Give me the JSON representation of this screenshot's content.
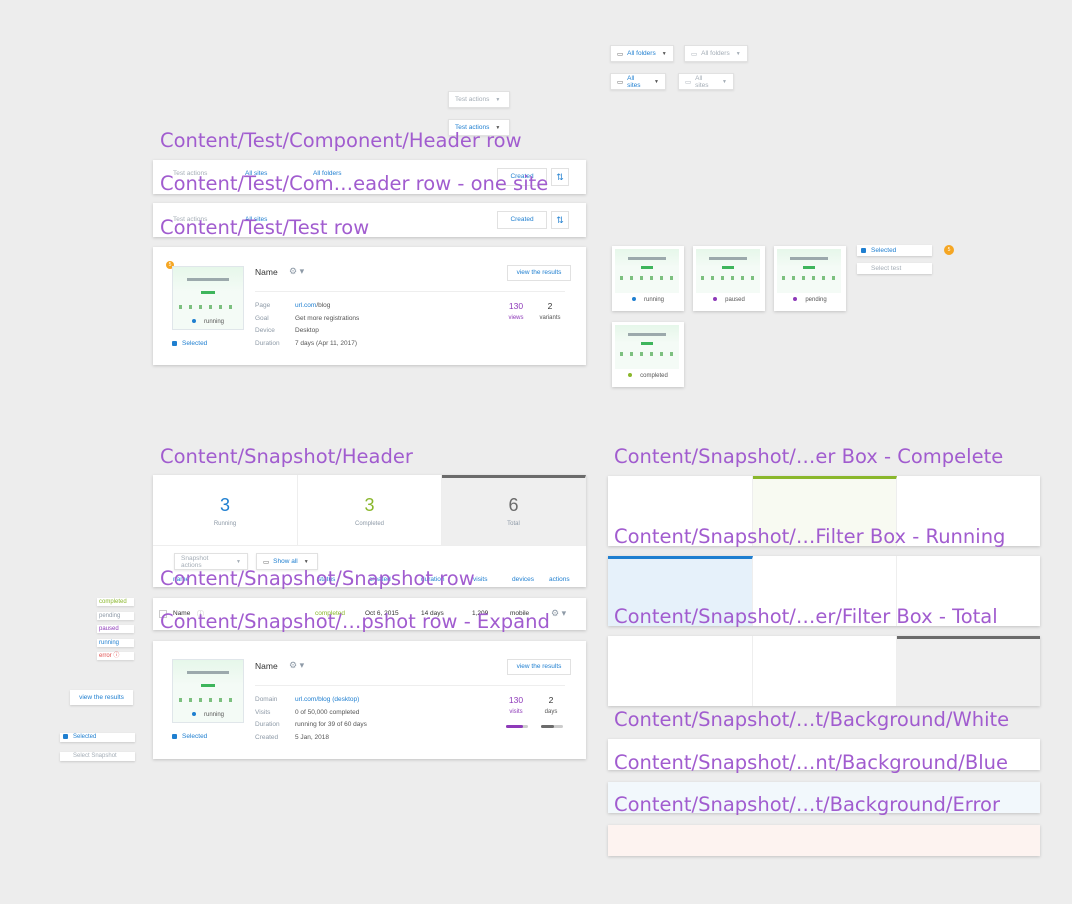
{
  "labels": {
    "header_row": "Content/Test/Component/Header row",
    "header_row_one_site": "Content/Test/Com…eader row - one site",
    "test_row": "Content/Test/Test row",
    "snapshot_header": "Content/Snapshot/Header",
    "snapshot_row": "Content/Snapshot/Snapshot row",
    "snapshot_row_expand": "Content/Snapshot/…pshot row - Expand",
    "filter_complete": "Content/Snapshot/…er Box - Compelete",
    "filter_running": "Content/Snapshot/…Filter Box - Running",
    "filter_total": "Content/Snapshot/…er/Filter Box - Total",
    "bg_white": "Content/Snapshot/…t/Background/White",
    "bg_blue": "Content/Snapshot/…nt/Background/Blue",
    "bg_error": "Content/Snapshot/…t/Background/Error"
  },
  "dropdowns": {
    "all_folders": "All folders",
    "all_sites": "All sites",
    "test_actions": "Test actions",
    "snapshot_actions": "Snapshot actions",
    "show_all": "Show all",
    "created": "Created"
  },
  "test_row": {
    "name": "Name",
    "view_results": "view the results",
    "selected": "Selected",
    "status": "running",
    "badge": "5",
    "thumb_headline": "Grow your website traffic.",
    "fields": [
      {
        "key": "Page",
        "value_a": "url.com",
        "value_b": "/blog"
      },
      {
        "key": "Goal",
        "value_a": "",
        "value_b": "Get more registrations"
      },
      {
        "key": "Device",
        "value_a": "",
        "value_b": "Desktop"
      },
      {
        "key": "Duration",
        "value_a": "",
        "value_b": "7 days (Apr 11, 2017)"
      }
    ],
    "views_value": "130",
    "views_label": "views",
    "variants_value": "2",
    "variants_label": "variants"
  },
  "thumbs": [
    {
      "status": "running",
      "color": "#1f7fd0"
    },
    {
      "status": "paused",
      "color": "#8e3ab9"
    },
    {
      "status": "pending",
      "color": "#8e3ab9"
    },
    {
      "status": "completed",
      "color": "#8ab72c"
    }
  ],
  "select_widget": {
    "selected": "Selected",
    "select_test": "Select test",
    "badge": "5"
  },
  "snapshot_header": {
    "boxes": [
      {
        "value": "3",
        "label": "Running"
      },
      {
        "value": "3",
        "label": "Completed"
      },
      {
        "value": "6",
        "label": "Total"
      }
    ],
    "columns": [
      "name",
      "status",
      "created",
      "duration",
      "visits",
      "devices",
      "actions"
    ]
  },
  "snapshot_row": {
    "name": "Name",
    "status": "completed",
    "date": "Oct 6, 2015",
    "duration": "14 days",
    "visits": "1,209",
    "device": "mobile"
  },
  "status_chips": [
    {
      "label": "completed",
      "color": "#8ab72c"
    },
    {
      "label": "pending",
      "color": "#8e9aa7"
    },
    {
      "label": "paused",
      "color": "#8e3ab9"
    },
    {
      "label": "running",
      "color": "#1f7fd0"
    },
    {
      "label": "error",
      "color": "#e04c4c"
    }
  ],
  "snapshot_expand": {
    "name": "Name",
    "view_results": "view the results",
    "selected": "Selected",
    "select_snapshot": "Select Snapshot",
    "status": "running",
    "fields": [
      {
        "key": "Domain",
        "value_a": "url.com",
        "value_b": "/blog",
        "value_c": "(desktop)"
      },
      {
        "key": "Visits",
        "value_a": "",
        "value_b": "0 of 50,000 completed",
        "value_c": ""
      },
      {
        "key": "Duration",
        "value_a": "",
        "value_b": "running for 39 of 60 days",
        "value_c": ""
      },
      {
        "key": "Created",
        "value_a": "",
        "value_b": "5 Jan, 2018",
        "value_c": ""
      }
    ],
    "visits_value": "130",
    "visits_label": "visits",
    "days_value": "2",
    "days_label": "days",
    "visits_progress": 0.75,
    "days_progress": 0.6
  },
  "colors": {
    "label": "#a15ccf",
    "blue": "#1f7fd0",
    "green": "#8ab72c",
    "purple": "#8e3ab9",
    "dark_bar": "#6b6b6b",
    "bg_blue": "#f2f8fc",
    "bg_error": "#fdf3f0"
  }
}
